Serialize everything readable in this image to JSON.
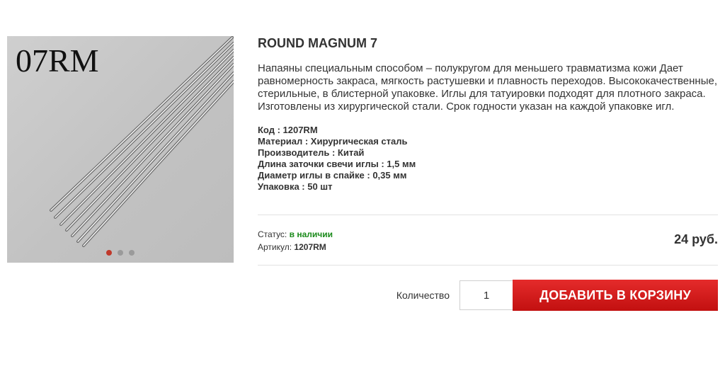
{
  "gallery": {
    "image_caption": "07RM",
    "slides": 3,
    "active_slide": 1
  },
  "product": {
    "title": "ROUND MAGNUM 7",
    "description": "Напаяны специальным способом – полукругом для меньшего травматизма кожи Дает равномерность закраса, мягкость растушевки и плавность переходов. Высококачественные, стерильные, в блистерной упаковке. Иглы для татуировки подходят для плотного закраса. Изготовлены из хирургической стали. Срок годности указан на каждой упаковке игл.",
    "specs": [
      "Код : 1207RM",
      "Материал : Хирургическая сталь",
      "Производитель : Китай",
      "Длина заточки свечи иглы : 1,5 мм",
      "Диаметр иглы в спайке : 0,35 мм",
      "Упаковка : 50 шт"
    ],
    "status_label": "Статус:",
    "status_value": "в наличии",
    "article_label": "Артикул:",
    "article_value": "1207RM",
    "price": "24 руб."
  },
  "purchase": {
    "quantity_label": "Количество",
    "quantity_value": "1",
    "add_button_label": "ДОБАВИТЬ В КОРЗИНУ"
  },
  "colors": {
    "accent": "#d21a1a",
    "in_stock": "#1a8a1a"
  }
}
